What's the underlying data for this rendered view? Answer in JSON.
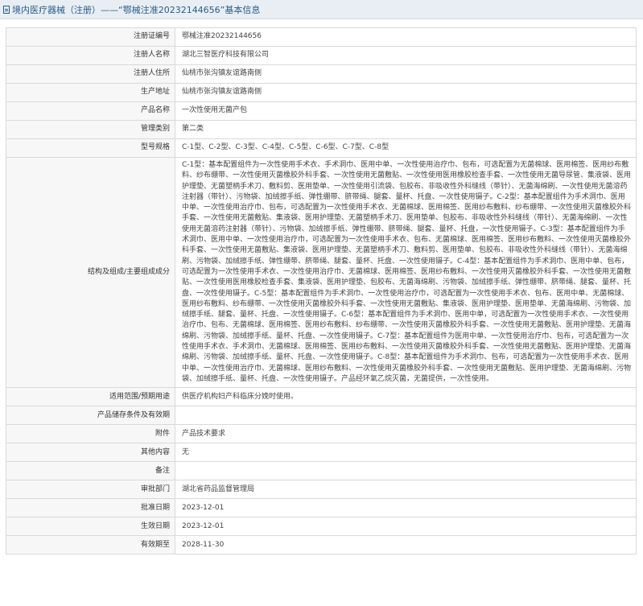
{
  "header": {
    "icon": "document-icon",
    "title": "境内医疗器械（注册）——“鄂械注准20232144656”基本信息"
  },
  "rows": [
    {
      "label": "注册证编号",
      "value": "鄂械注准20232144656"
    },
    {
      "label": "注册人名称",
      "value": "湖北三智医疗科技有限公司"
    },
    {
      "label": "注册人住所",
      "value": "仙桃市张沟镇友谊路南侧"
    },
    {
      "label": "生产地址",
      "value": "仙桃市张沟镇友谊路南侧"
    },
    {
      "label": "产品名称",
      "value": "一次性使用无菌产包"
    },
    {
      "label": "管理类别",
      "value": "第二类"
    },
    {
      "label": "型号规格",
      "value": "C-1型、C-2型、C-3型、C-4型、C-5型、C-6型、C-7型、C-8型"
    },
    {
      "label": "结构及组成/主要组成成分",
      "value": "C-1型：基本配置组件为一次性使用手术衣、手术洞巾、医用中单、一次性使用治疗巾、包布，可选配置为无菌棉球、医用棉签、医用纱布敷料、纱布绷带、一次性使用灭菌橡胶外科手套、一次性使用无菌敷贴、一次性使用医用橡胶检查手套、一次性使用无菌导尿管、集液袋、医用护理垫、无菌塑柄手术刀、敷料剪、医用垫单、一次性使用引流袋、包胶布、非吸收性外科缝线（带针）、无菌海绵刷、一次性使用无菌溶药注射器（带针）、污物袋、加绒擦手纸、弹性绷带、脐带绳、腿套、量杯、托盘、一次性使用镊子。C-2型：基本配置组件为手术洞巾、医用中单、一次性使用治疗巾、包布，可选配置为一次性使用手术衣、无菌棉球、医用棉签、医用纱布敷料、纱布绷带、一次性使用灭菌橡胶外科手套、一次性使用无菌敷贴、集液袋、医用护理垫、无菌塑柄手术刀、医用垫单、包胶布、非吸收性外科缝线（带针）、无菌海绵刷、一次性使用无菌溶药注射器（带针）、污物袋、加绒擦手纸、弹性绷带、脐带绳、腿套、量杯、托盘，一次性使用镊子。C-3型：基本配置组件为手术洞巾、医用中单、一次性使用治疗巾，可选配置为一次性使用手术衣、包布、无菌棉球、医用棉签、医用纱布敷料、一次性使用灭菌橡胶外科手套、一次性使用无菌敷贴、集液袋、医用护理垫、无菌塑柄手术刀、敷料剪、医用垫单、包胶布、非吸收性外科缝线（带针）、无菌海绵刷、污物袋、加绒擦手纸、弹性绷带、脐带绳、腿套、量杯、托盘、一次性使用镊子。C-4型：基本配置组件为手术洞巾、医用中单、包布，可选配置为一次性使用手术衣、一次性使用治疗巾、无菌棉球、医用棉签、医用纱布敷料、一次性使用灭菌橡胶外科手套、一次性使用无菌敷贴、一次性使用医用橡胶检查手套、集液袋、医用护理垫、包胶布、无菌海绵刷、污物袋、加绒擦手纸、弹性绷带、脐带绳、腿套、量杯、托盘、一次性使用镊子。C-5型：基本配置组件为手术洞巾、一次性使用治疗巾，可选配置为一次性使用手术衣、包布、医用中单、无菌棉球、医用纱布敷料、纱布绷带、一次性使用灭菌橡胶外科手套、一次性使用无菌敷贴、集液袋、医用护理垫、医用垫单、无菌海绵刷、污物袋、加绒擦手纸、腿套、量杯、托盘、一次性使用镊子。C-6型：基本配置组件为手术洞巾、医用中单，可选配置为一次性使用手术衣、一次性使用治疗巾、包布、无菌棉球、医用棉签、医用纱布敷料、纱布绷带、一次性使用灭菌橡胶外科手套、一次性使用无菌敷贴、医用护理垫、无菌海绵刷、污物袋、加绒擦手纸、量杯、托盘、一次性使用镊子。C-7型：基本配置组件为医用中单、一次性使用治疗巾、包布，可选配置为一次性使用手术衣、手术洞巾、无菌棉球、医用棉签、医用纱布敷料、一次性使用灭菌橡胶外科手套、一次性使用无菌敷贴、医用护理垫、无菌海绵刷、污物袋、加绒擦手纸、量杯、托盘、一次性使用镊子。C-8型：基本配置组件为手术洞巾、包布，可选配置为一次性使用手术衣、医用中单、一次性使用治疗巾、无菌棉球、医用纱布敷料、一次性使用灭菌橡胶外科手套、一次性使用无菌敷贴、医用护理垫、无菌海绵刷、污物袋、加绒擦手纸、量杯、托盘、一次性使用镊子。产品经环氧乙烷灭菌，无菌提供，一次性使用。"
    },
    {
      "label": "适用范围/预期用途",
      "value": "供医疗机构妇产科临床分娩时使用。"
    },
    {
      "label": "产品储存条件及有效期",
      "value": ""
    },
    {
      "label": "附件",
      "value": "产品技术要求"
    },
    {
      "label": "其他内容",
      "value": "无"
    },
    {
      "label": "备注",
      "value": ""
    },
    {
      "label": "审批部门",
      "value": "湖北省药品监督管理局"
    },
    {
      "label": "批准日期",
      "value": "2023-12-01"
    },
    {
      "label": "生效日期",
      "value": "2023-12-01"
    },
    {
      "label": "有效期至",
      "value": "2028-11-30"
    }
  ]
}
